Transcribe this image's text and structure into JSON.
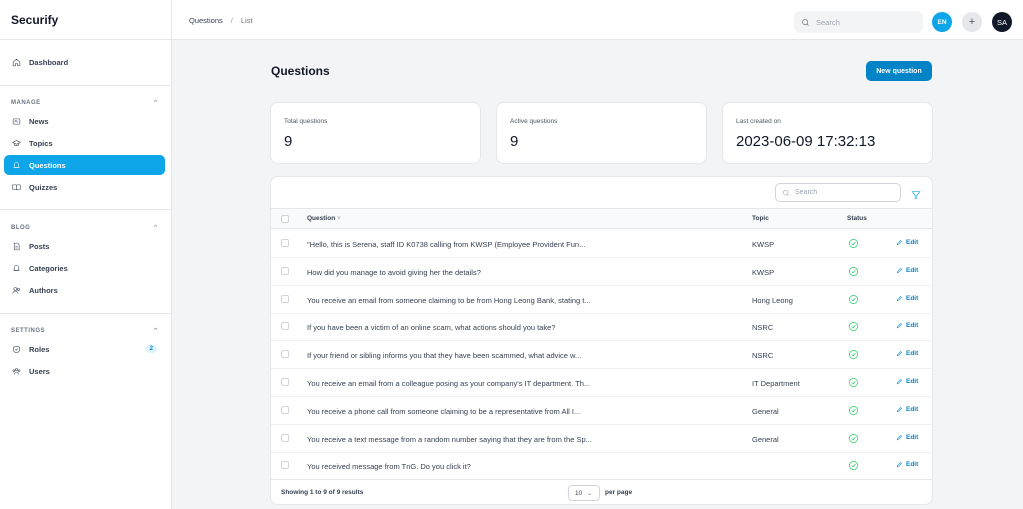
{
  "app": {
    "name": "Securify"
  },
  "sidebar": {
    "dashboard": "Dashboard",
    "sections": [
      {
        "title": "MANAGE",
        "items": [
          {
            "label": "News",
            "icon": "newspaper-icon"
          },
          {
            "label": "Topics",
            "icon": "graduation-cap-icon"
          },
          {
            "label": "Questions",
            "icon": "bell-icon",
            "active": true
          },
          {
            "label": "Quizzes",
            "icon": "book-open-icon"
          }
        ]
      },
      {
        "title": "BLOG",
        "items": [
          {
            "label": "Posts",
            "icon": "document-icon"
          },
          {
            "label": "Categories",
            "icon": "bell-icon"
          },
          {
            "label": "Authors",
            "icon": "users-icon"
          }
        ]
      },
      {
        "title": "SETTINGS",
        "items": [
          {
            "label": "Roles",
            "icon": "shield-icon",
            "badge": "2"
          },
          {
            "label": "Users",
            "icon": "user-group-icon"
          }
        ]
      }
    ]
  },
  "topbar": {
    "breadcrumbs": [
      "Questions",
      "List"
    ],
    "search_placeholder": "Search",
    "lang": "EN",
    "plus": "+",
    "avatar": "SA"
  },
  "page": {
    "title": "Questions",
    "new_button": "New question"
  },
  "stats": [
    {
      "label": "Total questions",
      "value": "9"
    },
    {
      "label": "Active questions",
      "value": "9"
    },
    {
      "label": "Last created on",
      "value": "2023-06-09 17:32:13"
    }
  ],
  "table": {
    "search_placeholder": "Search",
    "columns": {
      "question": "Question",
      "topic": "Topic",
      "status": "Status"
    },
    "edit_label": "Edit",
    "rows": [
      {
        "question": "\"Hello, this is Serena, staff ID K0738 calling from KWSP (Employee Provident Fun...",
        "topic": "KWSP"
      },
      {
        "question": "How did you manage to avoid giving her the details?",
        "topic": "KWSP"
      },
      {
        "question": "You receive an email from someone claiming to be from Hong Leong Bank, stating t...",
        "topic": "Hong Leong"
      },
      {
        "question": "If you have been a victim of an online scam, what actions should you take?",
        "topic": "NSRC"
      },
      {
        "question": "If your friend or sibling informs you that they have been scammed, what advice w...",
        "topic": "NSRC"
      },
      {
        "question": "You receive an email from a colleague posing as your company's IT department. Th...",
        "topic": "IT Department"
      },
      {
        "question": "You receive a phone call from someone claiming to be a representative from All I...",
        "topic": "General"
      },
      {
        "question": "You receive a text message from a random number saying that they are from the Sp...",
        "topic": "General"
      },
      {
        "question": "You received message from TnG. Do you click it?",
        "topic": ""
      }
    ],
    "footer": {
      "info": "Showing 1 to 9 of 9 results",
      "per_page_value": "10",
      "per_page_label": "per page"
    }
  },
  "colors": {
    "accent": "#0ea5e9",
    "primary_button": "#0284c7",
    "success": "#22c55e"
  }
}
